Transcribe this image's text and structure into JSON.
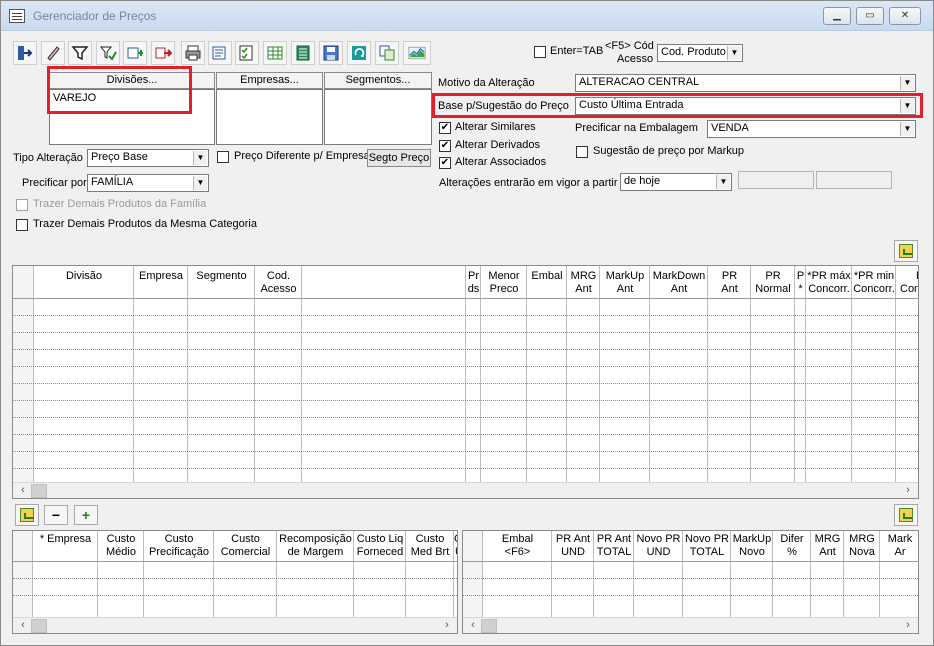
{
  "window": {
    "title": "Gerenciador de Preços"
  },
  "toolbar": {
    "enter_tab_label": "Enter=TAB",
    "cod_acesso_line1": "<F5> Cód",
    "cod_acesso_line2": "Acesso",
    "cod_acesso_value": "Cod. Produto"
  },
  "filters": {
    "divisoes_header": "Divisões...",
    "empresas_header": "Empresas...",
    "segmentos_header": "Segmentos...",
    "divisoes_items": [
      "VAREJO"
    ],
    "tipo_alteracao_label": "Tipo Alteração",
    "tipo_alteracao_value": "Preço Base",
    "preco_diferente_label": "Preço Diferente p/ Empresa",
    "segto_preco_button": "Segto Preço",
    "precificar_por_label": "Precificar por",
    "precificar_por_value": "FAMÍLIA",
    "trazer_familia_label": "Trazer Demais Produtos da Família",
    "trazer_categoria_label": "Trazer Demais Produtos da Mesma Categoria"
  },
  "options": {
    "motivo_label": "Motivo da Alteração",
    "motivo_value": "ALTERACAO CENTRAL",
    "base_label": "Base p/Sugestão do Preço",
    "base_value": "Custo Última Entrada",
    "alterar_similares": "Alterar Similares",
    "alterar_derivados": "Alterar Derivados",
    "alterar_associados": "Alterar Associados",
    "precificar_embalagem_label": "Precificar na Embalagem",
    "precificar_embalagem_value": "VENDA",
    "sugestao_markup_label": "Sugestão de preço por Markup",
    "vigor_label": "Alterações entrarão em vigor a partir",
    "vigor_value": "de hoje"
  },
  "main_grid": {
    "headers": [
      {
        "l1": "Divisão",
        "l2": ""
      },
      {
        "l1": "Empresa",
        "l2": ""
      },
      {
        "l1": "Segmento",
        "l2": ""
      },
      {
        "l1": "Cod.",
        "l2": "Acesso"
      },
      {
        "l1": "",
        "l2": ""
      },
      {
        "l1": "Pr",
        "l2": "ds"
      },
      {
        "l1": "Menor",
        "l2": "Preco"
      },
      {
        "l1": "Embal",
        "l2": ""
      },
      {
        "l1": "MRG",
        "l2": "Ant"
      },
      {
        "l1": "MarkUp",
        "l2": "Ant"
      },
      {
        "l1": "MarkDown",
        "l2": "Ant"
      },
      {
        "l1": "PR",
        "l2": "Ant"
      },
      {
        "l1": "PR",
        "l2": "Normal"
      },
      {
        "l1": "P",
        "l2": "*"
      },
      {
        "l1": "*PR máx",
        "l2": "Concorr."
      },
      {
        "l1": "*PR min",
        "l2": "Concorr."
      },
      {
        "l1": "PR",
        "l2": "Conco"
      }
    ]
  },
  "bottom_left_grid": {
    "headers": [
      {
        "l1": "* Empresa",
        "l2": ""
      },
      {
        "l1": "Custo",
        "l2": "Médio"
      },
      {
        "l1": "Custo",
        "l2": "Precificação"
      },
      {
        "l1": "Custo",
        "l2": "Comercial"
      },
      {
        "l1": "Recomposição",
        "l2": "de Margem"
      },
      {
        "l1": "Custo Liq",
        "l2": "Forneced"
      },
      {
        "l1": "Custo",
        "l2": "Med Brt"
      },
      {
        "l1": "Cu",
        "l2": "Ú"
      }
    ]
  },
  "bottom_right_grid": {
    "headers": [
      {
        "l1": "Embal",
        "l2": "<F6>"
      },
      {
        "l1": "PR Ant",
        "l2": "UND"
      },
      {
        "l1": "PR Ant",
        "l2": "TOTAL"
      },
      {
        "l1": "Novo PR",
        "l2": "UND"
      },
      {
        "l1": "Novo PR",
        "l2": "TOTAL"
      },
      {
        "l1": "MarkUp",
        "l2": "Novo"
      },
      {
        "l1": "Difer",
        "l2": "%"
      },
      {
        "l1": "MRG",
        "l2": "Ant"
      },
      {
        "l1": "MRG",
        "l2": "Nova"
      },
      {
        "l1": "Mark",
        "l2": "Ar"
      }
    ]
  },
  "buttons": {
    "minus": "−",
    "plus": "+"
  }
}
